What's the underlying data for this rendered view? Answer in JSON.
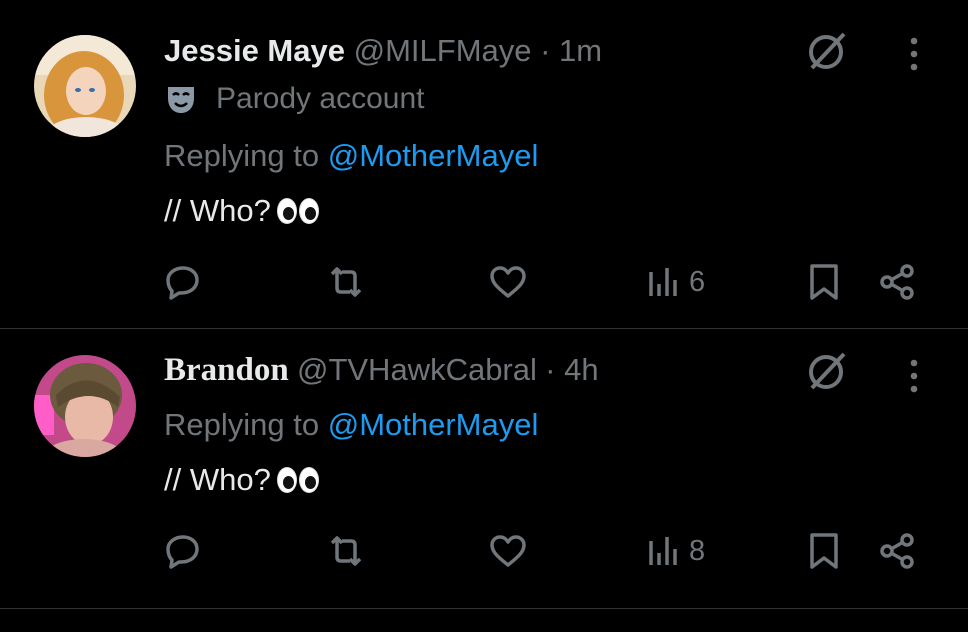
{
  "tweets": [
    {
      "display_name": "Jessie Maye",
      "handle": "@MILFMaye",
      "time": "· 1m",
      "parody_label": "Parody account",
      "replying_prefix": "Replying to ",
      "replying_to": "@MotherMayel",
      "text": "// Who?",
      "views": "6"
    },
    {
      "display_name": "Brandon",
      "handle": "@TVHawkCabral",
      "time": "· 4h",
      "replying_prefix": "Replying to ",
      "replying_to": "@MotherMayel",
      "text": "// Who?",
      "views": "8"
    }
  ],
  "colors": {
    "background": "#000000",
    "muted": "#71767b",
    "link": "#1d9bf0",
    "text": "#e7e9ea",
    "divider": "#2f3336"
  },
  "icons": [
    "reply-icon",
    "retweet-icon",
    "like-icon",
    "views-icon",
    "bookmark-icon",
    "share-icon",
    "grok-icon",
    "more-icon",
    "parody-mask-icon",
    "eyes-emoji"
  ]
}
